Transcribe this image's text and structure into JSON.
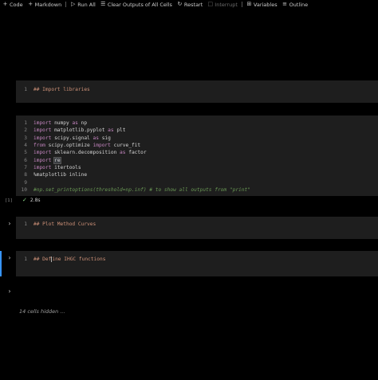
{
  "toolbar": {
    "code": "Code",
    "markdown": "Markdown",
    "run_all": "Run All",
    "clear_outputs": "Clear Outputs of All Cells",
    "restart": "Restart",
    "interrupt": "Interrupt",
    "variables": "Variables",
    "outline": "Outline",
    "icons": {
      "code": "plus-icon",
      "markdown": "plus-icon",
      "run_all": "run-all-icon",
      "clear_outputs": "clear-all-icon",
      "restart": "restart-icon",
      "interrupt": "stop-icon",
      "variables": "variables-icon",
      "outline": "outline-icon"
    }
  },
  "cells": {
    "md1": {
      "line_no": "1",
      "text": "## Import libraries"
    },
    "code1": {
      "lines": [
        {
          "n": "1",
          "a": "import",
          "b": " numpy ",
          "c": "as",
          "d": " np"
        },
        {
          "n": "2",
          "a": "import",
          "b": " matplotlib.pyplot ",
          "c": "as",
          "d": " plt"
        },
        {
          "n": "3",
          "a": "import",
          "b": " scipy.signal ",
          "c": "as",
          "d": " sig"
        },
        {
          "n": "4",
          "a": "from",
          "b": " scipy.optimize ",
          "c": "import",
          "d": " curve_fit"
        },
        {
          "n": "5",
          "a": "import",
          "b": " sklearn.decomposition ",
          "c": "as",
          "d": " factor"
        },
        {
          "n": "6",
          "a": "import",
          "b": " ",
          "c": "re",
          "d": ""
        },
        {
          "n": "7",
          "a": "import",
          "b": " itertools",
          "c": "",
          "d": ""
        },
        {
          "n": "8",
          "a": "%matplotlib inline",
          "b": "",
          "c": "",
          "d": ""
        },
        {
          "n": "9",
          "a": "",
          "b": "",
          "c": "",
          "d": ""
        },
        {
          "n": "10",
          "a": "#np.set_printoptions(threshold=np.inf) # to show all outputs from \"print\"",
          "b": "",
          "c": "",
          "d": ""
        }
      ],
      "exec_count": "[1]",
      "status_time": "2.8s"
    },
    "md2": {
      "line_no": "1",
      "text": "## Plot Method Curves"
    },
    "md3": {
      "line_no": "1",
      "text_before": "## Def",
      "text_after": "ine IHGC functions"
    }
  },
  "hidden_cells": "14 cells hidden ...",
  "colors": {
    "background": "#000000",
    "cell_bg": "#1e1e1e",
    "markdown_text": "#ce9178",
    "keyword": "#c586c0",
    "comment": "#6a9955",
    "line_number": "#858585",
    "active_indicator": "#3794ff",
    "success": "#89d185"
  }
}
